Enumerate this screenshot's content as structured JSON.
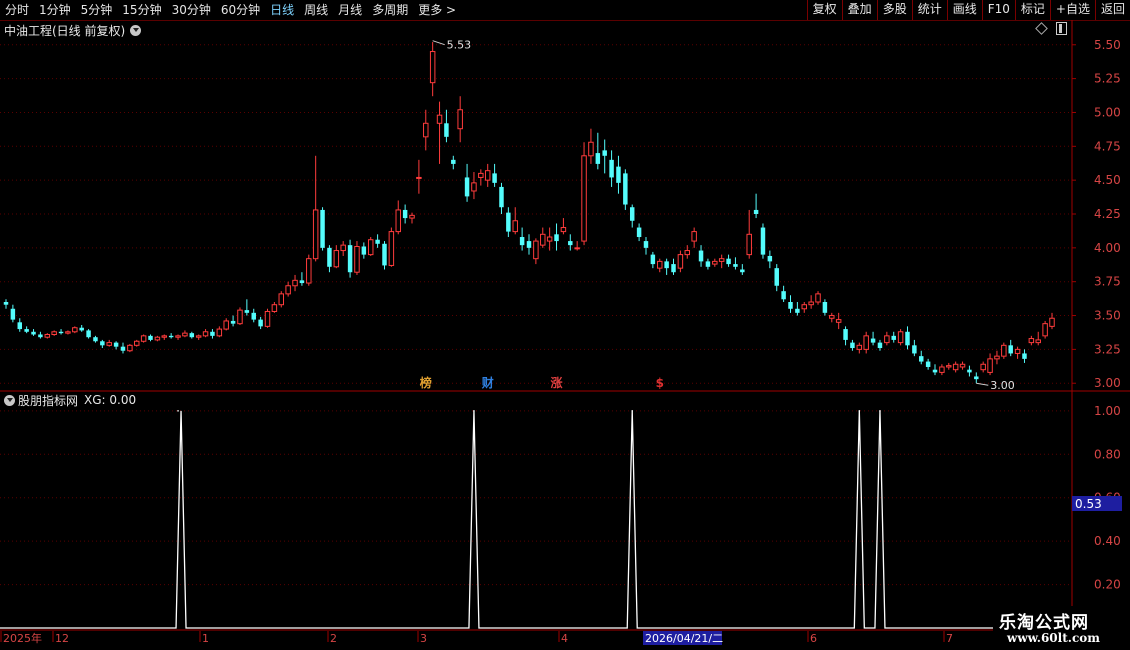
{
  "toolbar": {
    "periods": [
      "分时",
      "1分钟",
      "5分钟",
      "15分钟",
      "30分钟",
      "60分钟",
      "日线",
      "周线",
      "月线",
      "多周期",
      "更多 >"
    ],
    "active": "日线",
    "right_buttons": [
      "复权",
      "叠加",
      "多股",
      "统计",
      "画线",
      "F10",
      "标记",
      "+自选",
      "返回"
    ]
  },
  "main": {
    "title": "中油工程(日线 前复权)"
  },
  "indicator": {
    "title": "股朋指标网",
    "value_text": "XG: 0.00",
    "cursor_value": "0.53"
  },
  "bottom": {
    "date_highlight": "2026/04/21/二"
  },
  "logo": {
    "line1": "乐淘公式网",
    "line2": "www.60lt.com"
  },
  "markers": [
    {
      "label": "榜",
      "color": "#e0a030"
    },
    {
      "label": "财",
      "color": "#3080e0"
    },
    {
      "label": "涨",
      "color": "#e04040"
    },
    {
      "label": "$",
      "color": "#e03030"
    }
  ],
  "colors": {
    "up": "#ff3c3c",
    "down": "#54fcfc",
    "axis": "#a00000",
    "grid": "#5a0000",
    "signal": "#ffffff"
  },
  "chart_data": [
    {
      "type": "candlestick",
      "title": "中油工程(日线 前复权)",
      "y_ticks": [
        3.0,
        3.25,
        3.5,
        3.75,
        4.0,
        4.25,
        4.5,
        4.75,
        5.0,
        5.25,
        5.5
      ],
      "ylim": [
        2.95,
        5.55
      ],
      "x_labels": [
        "2025年",
        "12",
        "1",
        "2",
        "3",
        "4",
        "5",
        "6",
        "7"
      ],
      "annotations": [
        {
          "text": "5.53",
          "value": 5.53
        },
        {
          "text": "3.00",
          "value": 3.0
        }
      ],
      "series": [
        {
          "name": "K线",
          "ohlc": [
            [
              3.6,
              3.62,
              3.55,
              3.58
            ],
            [
              3.55,
              3.58,
              3.45,
              3.47
            ],
            [
              3.45,
              3.48,
              3.38,
              3.4
            ],
            [
              3.4,
              3.42,
              3.37,
              3.38
            ],
            [
              3.38,
              3.4,
              3.35,
              3.36
            ],
            [
              3.36,
              3.38,
              3.33,
              3.34
            ],
            [
              3.34,
              3.37,
              3.33,
              3.36
            ],
            [
              3.36,
              3.39,
              3.35,
              3.38
            ],
            [
              3.38,
              3.4,
              3.36,
              3.37
            ],
            [
              3.37,
              3.39,
              3.36,
              3.38
            ],
            [
              3.38,
              3.42,
              3.37,
              3.41
            ],
            [
              3.41,
              3.43,
              3.38,
              3.39
            ],
            [
              3.39,
              3.4,
              3.33,
              3.34
            ],
            [
              3.34,
              3.35,
              3.3,
              3.31
            ],
            [
              3.31,
              3.32,
              3.26,
              3.28
            ],
            [
              3.28,
              3.32,
              3.27,
              3.3
            ],
            [
              3.3,
              3.31,
              3.25,
              3.27
            ],
            [
              3.27,
              3.3,
              3.22,
              3.24
            ],
            [
              3.24,
              3.29,
              3.23,
              3.28
            ],
            [
              3.28,
              3.32,
              3.27,
              3.31
            ],
            [
              3.31,
              3.36,
              3.3,
              3.35
            ],
            [
              3.35,
              3.36,
              3.31,
              3.32
            ],
            [
              3.32,
              3.35,
              3.31,
              3.34
            ],
            [
              3.34,
              3.36,
              3.32,
              3.35
            ],
            [
              3.35,
              3.37,
              3.33,
              3.34
            ],
            [
              3.34,
              3.36,
              3.32,
              3.35
            ],
            [
              3.35,
              3.39,
              3.34,
              3.37
            ],
            [
              3.37,
              3.38,
              3.33,
              3.34
            ],
            [
              3.34,
              3.36,
              3.32,
              3.35
            ],
            [
              3.35,
              3.4,
              3.34,
              3.38
            ],
            [
              3.38,
              3.4,
              3.33,
              3.35
            ],
            [
              3.35,
              3.42,
              3.34,
              3.4
            ],
            [
              3.4,
              3.48,
              3.39,
              3.46
            ],
            [
              3.46,
              3.5,
              3.42,
              3.44
            ],
            [
              3.44,
              3.56,
              3.43,
              3.54
            ],
            [
              3.54,
              3.62,
              3.5,
              3.52
            ],
            [
              3.52,
              3.55,
              3.45,
              3.47
            ],
            [
              3.47,
              3.49,
              3.4,
              3.42
            ],
            [
              3.42,
              3.55,
              3.41,
              3.53
            ],
            [
              3.53,
              3.6,
              3.52,
              3.58
            ],
            [
              3.58,
              3.68,
              3.56,
              3.66
            ],
            [
              3.66,
              3.75,
              3.64,
              3.72
            ],
            [
              3.72,
              3.8,
              3.68,
              3.76
            ],
            [
              3.76,
              3.82,
              3.72,
              3.74
            ],
            [
              3.74,
              3.95,
              3.72,
              3.92
            ],
            [
              3.92,
              4.68,
              3.9,
              4.28
            ],
            [
              4.28,
              4.3,
              3.98,
              4.0
            ],
            [
              4.0,
              4.02,
              3.82,
              3.86
            ],
            [
              3.86,
              4.02,
              3.85,
              3.98
            ],
            [
              3.98,
              4.05,
              3.94,
              4.02
            ],
            [
              4.02,
              4.06,
              3.78,
              3.82
            ],
            [
              3.82,
              4.05,
              3.8,
              4.01
            ],
            [
              4.01,
              4.04,
              3.92,
              3.95
            ],
            [
              3.95,
              4.08,
              3.94,
              4.06
            ],
            [
              4.06,
              4.1,
              4.0,
              4.03
            ],
            [
              4.03,
              4.05,
              3.84,
              3.87
            ],
            [
              3.87,
              4.15,
              3.86,
              4.12
            ],
            [
              4.12,
              4.35,
              4.1,
              4.28
            ],
            [
              4.28,
              4.32,
              4.18,
              4.22
            ],
            [
              4.22,
              4.26,
              4.18,
              4.24
            ],
            [
              4.52,
              4.65,
              4.4,
              4.52
            ],
            [
              4.82,
              5.02,
              4.72,
              4.92
            ],
            [
              5.22,
              5.52,
              5.12,
              5.45
            ],
            [
              4.92,
              5.08,
              4.62,
              4.98
            ],
            [
              4.92,
              5.02,
              4.78,
              4.82
            ],
            [
              4.65,
              4.68,
              4.58,
              4.62
            ],
            [
              4.88,
              5.12,
              4.78,
              5.02
            ],
            [
              4.52,
              4.62,
              4.34,
              4.38
            ],
            [
              4.42,
              4.56,
              4.36,
              4.48
            ],
            [
              4.52,
              4.58,
              4.46,
              4.55
            ],
            [
              4.5,
              4.62,
              4.45,
              4.57
            ],
            [
              4.55,
              4.62,
              4.45,
              4.48
            ],
            [
              4.45,
              4.48,
              4.25,
              4.3
            ],
            [
              4.26,
              4.3,
              4.08,
              4.12
            ],
            [
              4.12,
              4.3,
              4.1,
              4.2
            ],
            [
              4.08,
              4.15,
              3.98,
              4.02
            ],
            [
              4.05,
              4.1,
              3.95,
              4.0
            ],
            [
              3.92,
              4.07,
              3.88,
              4.05
            ],
            [
              4.02,
              4.15,
              4.0,
              4.1
            ],
            [
              4.05,
              4.15,
              3.98,
              4.08
            ],
            [
              4.1,
              4.18,
              3.98,
              4.05
            ],
            [
              4.12,
              4.22,
              4.1,
              4.15
            ],
            [
              4.05,
              4.1,
              3.98,
              4.02
            ],
            [
              4.0,
              4.05,
              3.98,
              4.0
            ],
            [
              4.05,
              4.78,
              4.02,
              4.68
            ],
            [
              4.68,
              4.88,
              4.62,
              4.78
            ],
            [
              4.7,
              4.85,
              4.58,
              4.62
            ],
            [
              4.72,
              4.8,
              4.55,
              4.68
            ],
            [
              4.65,
              4.72,
              4.45,
              4.52
            ],
            [
              4.6,
              4.68,
              4.4,
              4.48
            ],
            [
              4.55,
              4.58,
              4.28,
              4.32
            ],
            [
              4.3,
              4.32,
              4.15,
              4.2
            ],
            [
              4.15,
              4.18,
              4.05,
              4.08
            ],
            [
              4.05,
              4.08,
              3.95,
              4.0
            ],
            [
              3.95,
              3.97,
              3.85,
              3.88
            ],
            [
              3.85,
              3.92,
              3.82,
              3.9
            ],
            [
              3.9,
              3.92,
              3.8,
              3.85
            ],
            [
              3.88,
              3.92,
              3.8,
              3.82
            ],
            [
              3.85,
              3.98,
              3.82,
              3.95
            ],
            [
              3.95,
              4.02,
              3.92,
              3.98
            ],
            [
              4.05,
              4.15,
              4.0,
              4.12
            ],
            [
              3.98,
              4.02,
              3.86,
              3.9
            ],
            [
              3.9,
              3.92,
              3.84,
              3.86
            ],
            [
              3.88,
              3.92,
              3.86,
              3.9
            ],
            [
              3.9,
              3.95,
              3.85,
              3.92
            ],
            [
              3.92,
              3.95,
              3.86,
              3.88
            ],
            [
              3.88,
              3.93,
              3.84,
              3.86
            ],
            [
              3.84,
              3.88,
              3.8,
              3.82
            ],
            [
              3.95,
              4.28,
              3.92,
              4.1
            ],
            [
              4.28,
              4.4,
              4.22,
              4.25
            ],
            [
              4.15,
              4.18,
              3.92,
              3.95
            ],
            [
              3.94,
              3.98,
              3.85,
              3.9
            ],
            [
              3.85,
              3.88,
              3.68,
              3.72
            ],
            [
              3.68,
              3.72,
              3.6,
              3.62
            ],
            [
              3.6,
              3.65,
              3.52,
              3.55
            ],
            [
              3.55,
              3.6,
              3.5,
              3.52
            ],
            [
              3.55,
              3.6,
              3.52,
              3.58
            ],
            [
              3.58,
              3.65,
              3.55,
              3.6
            ],
            [
              3.6,
              3.68,
              3.58,
              3.66
            ],
            [
              3.6,
              3.62,
              3.5,
              3.52
            ],
            [
              3.48,
              3.52,
              3.45,
              3.5
            ],
            [
              3.45,
              3.52,
              3.4,
              3.47
            ],
            [
              3.4,
              3.42,
              3.28,
              3.32
            ],
            [
              3.3,
              3.32,
              3.24,
              3.26
            ],
            [
              3.25,
              3.3,
              3.22,
              3.28
            ],
            [
              3.25,
              3.38,
              3.22,
              3.35
            ],
            [
              3.33,
              3.38,
              3.28,
              3.3
            ],
            [
              3.3,
              3.32,
              3.24,
              3.26
            ],
            [
              3.3,
              3.38,
              3.28,
              3.35
            ],
            [
              3.35,
              3.38,
              3.3,
              3.32
            ],
            [
              3.3,
              3.4,
              3.28,
              3.38
            ],
            [
              3.38,
              3.42,
              3.25,
              3.28
            ],
            [
              3.28,
              3.32,
              3.2,
              3.22
            ],
            [
              3.2,
              3.24,
              3.14,
              3.16
            ],
            [
              3.16,
              3.18,
              3.1,
              3.12
            ],
            [
              3.1,
              3.14,
              3.06,
              3.08
            ],
            [
              3.08,
              3.14,
              3.06,
              3.12
            ],
            [
              3.12,
              3.15,
              3.1,
              3.13
            ],
            [
              3.1,
              3.16,
              3.08,
              3.14
            ],
            [
              3.12,
              3.16,
              3.1,
              3.14
            ],
            [
              3.1,
              3.13,
              3.05,
              3.08
            ],
            [
              3.05,
              3.08,
              3.0,
              3.03
            ],
            [
              3.1,
              3.16,
              3.08,
              3.14
            ],
            [
              3.08,
              3.22,
              3.06,
              3.18
            ],
            [
              3.18,
              3.24,
              3.14,
              3.2
            ],
            [
              3.2,
              3.3,
              3.18,
              3.28
            ],
            [
              3.28,
              3.32,
              3.2,
              3.22
            ],
            [
              3.22,
              3.27,
              3.18,
              3.25
            ],
            [
              3.22,
              3.25,
              3.15,
              3.18
            ],
            [
              3.3,
              3.35,
              3.28,
              3.33
            ],
            [
              3.3,
              3.38,
              3.28,
              3.32
            ],
            [
              3.35,
              3.46,
              3.33,
              3.44
            ],
            [
              3.42,
              3.52,
              3.4,
              3.48
            ]
          ]
        }
      ]
    },
    {
      "type": "line",
      "title": "股朋指标网",
      "y_ticks": [
        0.2,
        0.4,
        0.6,
        0.8,
        1.0
      ],
      "ylim": [
        0.0,
        1.05
      ],
      "series": [
        {
          "name": "XG",
          "signal_index": [
            25,
            68,
            91,
            124,
            127
          ],
          "values_at_signal": [
            1,
            1,
            1,
            1,
            1
          ],
          "baseline": 0
        }
      ]
    }
  ]
}
